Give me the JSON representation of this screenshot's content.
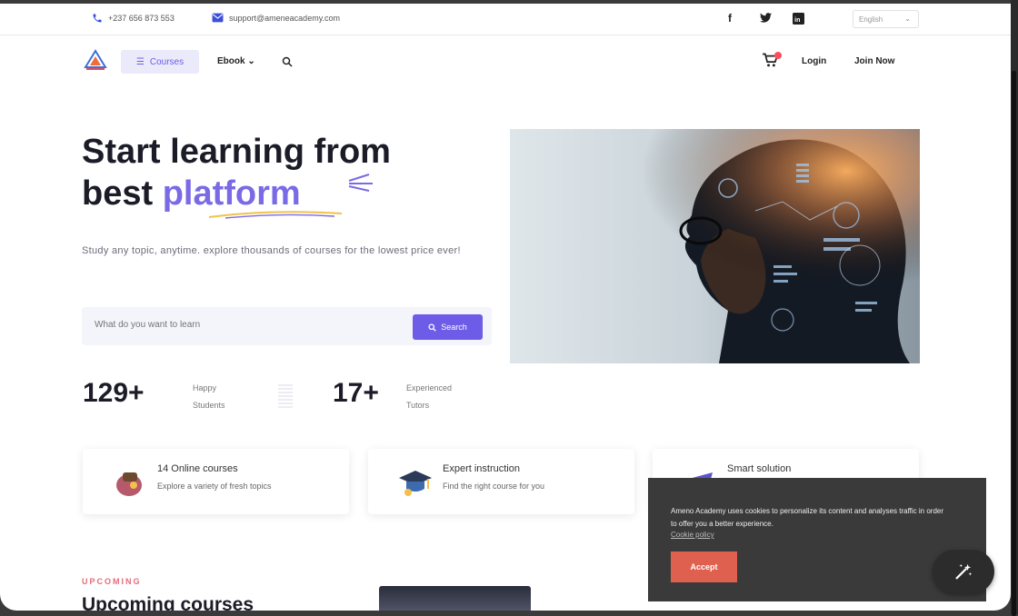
{
  "topbar": {
    "phone": "+237 656 873 553",
    "email": "support@ameneacademy.com",
    "social": {
      "facebook": "f",
      "twitter": "twitter-icon",
      "linkedin": "in"
    },
    "language": "English"
  },
  "nav": {
    "courses_label": "Courses",
    "ebook_label": "Ebook",
    "login_label": "Login",
    "join_label": "Join Now"
  },
  "hero": {
    "title_line1": "Start learning from",
    "title_line2_prefix": "best ",
    "title_line2_accent": "platform",
    "subtitle": "Study any topic, anytime. explore thousands of courses for the lowest price ever!",
    "search_placeholder": "What do you want to learn",
    "search_button": "Search",
    "stats": [
      {
        "value": "129+",
        "label_line1": "Happy",
        "label_line2": "Students"
      },
      {
        "value": "17+",
        "label_line1": "Experienced",
        "label_line2": "Tutors"
      }
    ]
  },
  "features": [
    {
      "title": "14 Online courses",
      "desc": "Explore a variety of fresh topics"
    },
    {
      "title": "Expert instruction",
      "desc": "Find the right course for you"
    },
    {
      "title": "Smart solution",
      "desc": ""
    }
  ],
  "upcoming": {
    "tag": "UPCOMING",
    "title": "Upcoming courses"
  },
  "cookie": {
    "text": "Ameno Academy uses cookies to personalize its content and analyses traffic in order to offer you a better experience.",
    "link": "Cookie policy",
    "accept": "Accept"
  },
  "colors": {
    "accent": "#6c5ce7",
    "accent_light": "#ebeafb",
    "cookie_bg": "#3a3a3a",
    "accept_bg": "#e0604f"
  }
}
